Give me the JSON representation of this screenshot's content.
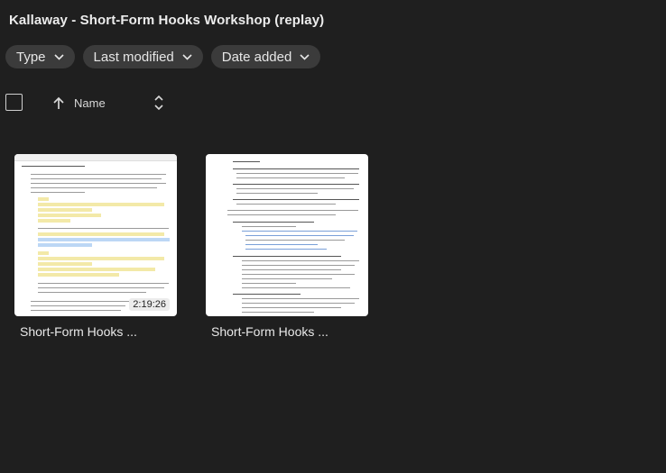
{
  "window": {
    "title": "Kallaway - Short-Form Hooks Workshop (replay)"
  },
  "filters": [
    {
      "label": "Type"
    },
    {
      "label": "Last modified"
    },
    {
      "label": "Date added"
    }
  ],
  "list_header": {
    "name_label": "Name"
  },
  "files": [
    {
      "title": "Short-Form Hooks ...",
      "duration": "2:19:26",
      "kind": "video"
    },
    {
      "title": "Short-Form Hooks ...",
      "kind": "document"
    }
  ],
  "icons": {
    "filter_chevron": "chevron-down-icon",
    "sort": "arrow-up-icon",
    "sort_toggle": "unfold-icon"
  },
  "colors": {
    "background": "#1f1f1f",
    "chip": "#3b3b3b",
    "text": "#e3e3e3"
  }
}
